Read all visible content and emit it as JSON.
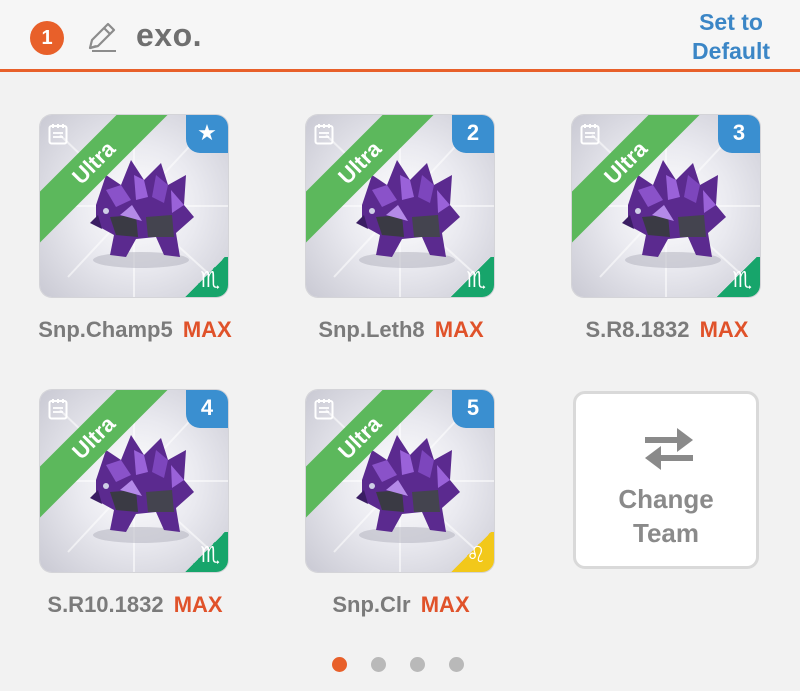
{
  "header": {
    "team_number": "1",
    "team_name": "exo.",
    "set_default_line1": "Set to",
    "set_default_line2": "Default",
    "accent_color": "#e8602a",
    "link_color": "#3b86c6"
  },
  "slots": [
    {
      "rarity": "Ultra",
      "corner": "★",
      "corner_icon": "star-icon",
      "sign": "♏",
      "sign_color": "#17a56b",
      "name": "Snp.Champ5",
      "level": "MAX"
    },
    {
      "rarity": "Ultra",
      "corner": "2",
      "corner_icon": "",
      "sign": "♏",
      "sign_color": "#17a56b",
      "name": "Snp.Leth8",
      "level": "MAX"
    },
    {
      "rarity": "Ultra",
      "corner": "3",
      "corner_icon": "",
      "sign": "♏",
      "sign_color": "#17a56b",
      "name": "S.R8.1832",
      "level": "MAX"
    },
    {
      "rarity": "Ultra",
      "corner": "4",
      "corner_icon": "",
      "sign": "♏",
      "sign_color": "#17a56b",
      "name": "S.R10.1832",
      "level": "MAX"
    },
    {
      "rarity": "Ultra",
      "corner": "5",
      "corner_icon": "",
      "sign": "♌",
      "sign_color": "#f2c81a",
      "name": "Snp.Clr",
      "level": "MAX"
    }
  ],
  "change_team": {
    "line1": "Change",
    "line2": "Team",
    "icon": "swap-arrows-icon"
  },
  "pager": {
    "total": 4,
    "active": 0,
    "active_color": "#e8602a",
    "inactive_color": "#b9b9b9"
  }
}
